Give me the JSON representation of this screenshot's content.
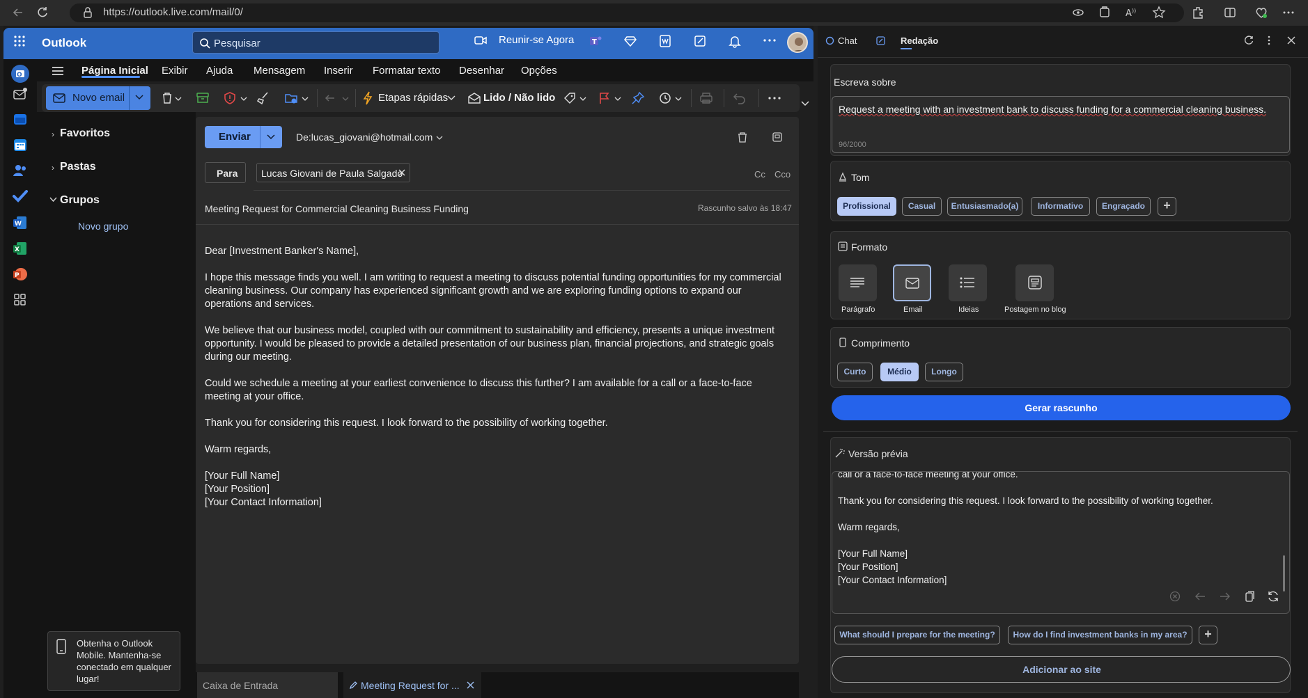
{
  "browser": {
    "url": "https://outlook.live.com/mail/0/"
  },
  "header": {
    "app_title": "Outlook",
    "search_placeholder": "Pesquisar",
    "meet_now": "Reunir-se Agora"
  },
  "tabs": [
    {
      "label": "Página Inicial",
      "active": true
    },
    {
      "label": "Exibir"
    },
    {
      "label": "Ajuda"
    },
    {
      "label": "Mensagem"
    },
    {
      "label": "Inserir"
    },
    {
      "label": "Formatar texto"
    },
    {
      "label": "Desenhar"
    },
    {
      "label": "Opções"
    }
  ],
  "ribbon": {
    "new_mail": "Novo email",
    "quick_steps": "Etapas rápidas",
    "read_unread": "Lido / Não lido"
  },
  "folders": {
    "favorites": "Favoritos",
    "folders": "Pastas",
    "groups": "Grupos",
    "new_group": "Novo grupo"
  },
  "mobile_promo": "Obtenha o Outlook Mobile. Mantenha-se conectado em qualquer lugar!",
  "compose": {
    "send": "Enviar",
    "from": "De:lucas_giovani@hotmail.com",
    "to_button": "Para",
    "recipient": "Lucas Giovani de Paula Salgado",
    "cc": "Cc",
    "bcc": "Cco",
    "subject": "Meeting Request for Commercial Cleaning Business Funding",
    "draft_saved": "Rascunho salvo às 18:47",
    "body": {
      "greeting": "Dear [Investment Banker's Name],",
      "p1": "I hope this message finds you well. I am writing to request a meeting to discuss potential funding opportunities for my commercial cleaning business. Our company has experienced significant growth and we are exploring funding options to expand our operations and services.",
      "p2": "We believe that our business model, coupled with our commitment to sustainability and efficiency, presents a unique investment opportunity. I would be pleased to provide a detailed presentation of our business plan, financial projections, and strategic goals during our meeting.",
      "p3": "Could we schedule a meeting at your earliest convenience to discuss this further? I am available for a call or a face-to-face meeting at your office.",
      "p4": "Thank you for considering this request. I look forward to the possibility of working together.",
      "closing": "Warm regards,",
      "sig1": "[Your Full Name]",
      "sig2": "[Your Position]",
      "sig3": "[Your Contact Information]"
    }
  },
  "bottom_tabs": {
    "inbox": "Caixa de Entrada",
    "draft": "Meeting Request for ..."
  },
  "copilot": {
    "tab_chat": "Chat",
    "tab_compose": "Redação",
    "write_about_label": "Escreva sobre",
    "prompt_text": "Request a meeting with an investment bank to discuss funding for a commercial cleaning business.",
    "char_count": "96/2000",
    "tone_label": "Tom",
    "tones": [
      {
        "label": "Profissional",
        "selected": true
      },
      {
        "label": "Casual"
      },
      {
        "label": "Entusiasmado(a)"
      },
      {
        "label": "Informativo"
      },
      {
        "label": "Engraçado"
      }
    ],
    "format_label": "Formato",
    "formats": [
      {
        "label": "Parágrafo"
      },
      {
        "label": "Email",
        "selected": true
      },
      {
        "label": "Ideias"
      },
      {
        "label": "Postagem no blog"
      }
    ],
    "length_label": "Comprimento",
    "lengths": [
      {
        "label": "Curto"
      },
      {
        "label": "Médio",
        "selected": true
      },
      {
        "label": "Longo"
      }
    ],
    "generate": "Gerar rascunho",
    "preview_label": "Versão prévia",
    "preview": {
      "cut_line": "call or a face-to-face meeting at your office.",
      "p4": "Thank you for considering this request. I look forward to the possibility of working together.",
      "closing": "Warm regards,",
      "sig1": "[Your Full Name]",
      "sig2": "[Your Position]",
      "sig3": "[Your Contact Information]"
    },
    "suggestions": [
      "What should I prepare for the meeting?",
      "How do I find investment banks in my area?"
    ],
    "add_to_site": "Adicionar ao site"
  },
  "colors": {
    "accent": "#4f8ef7",
    "header_blue": "#2f6bc4",
    "generate_blue": "#2563eb"
  }
}
